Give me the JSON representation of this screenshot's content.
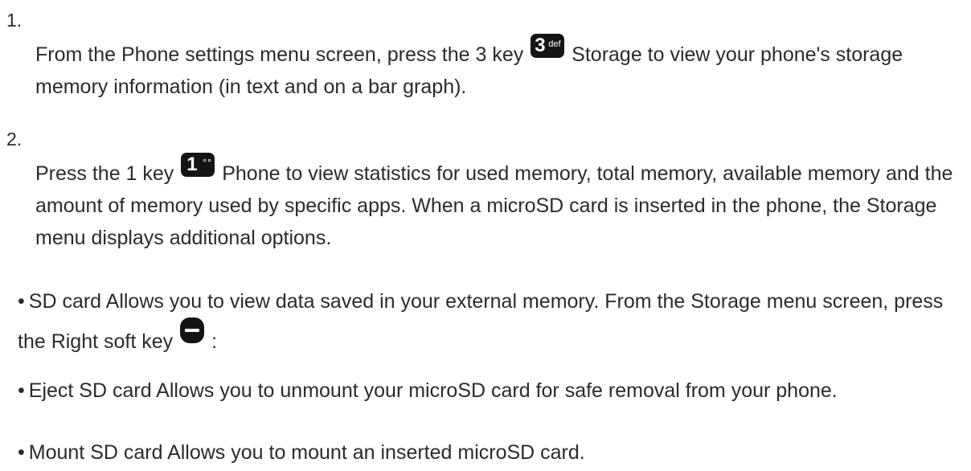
{
  "steps": [
    {
      "number": "1.",
      "text_before": "From the Phone settings menu screen, press the 3 key",
      "key": {
        "main": "3",
        "sub": "def",
        "icon": "key-3-def-icon"
      },
      "text_after": "Storage to view your phone's storage memory information (in text and on a bar graph)."
    },
    {
      "number": "2.",
      "text_before": "Press the 1 key",
      "key": {
        "main": "1",
        "sub": "∘∘",
        "icon": "key-1-voicemail-icon"
      },
      "text_after": "Phone to view statistics for used memory, total memory, available memory and the amount of memory used by specific apps. When a microSD card is inserted in the phone, the Storage menu displays additional options."
    }
  ],
  "bullets": [
    {
      "text_before": "SD card Allows you to view data saved in your external memory. From the Storage menu screen, press the Right soft key",
      "key_icon": "right-soft-key-icon",
      "text_after": ":"
    },
    {
      "text": "Eject SD card Allows you to unmount your microSD card for safe removal from your phone."
    },
    {
      "text": "Mount SD card Allows you to mount an inserted microSD card."
    }
  ],
  "bullet_symbol": "•"
}
